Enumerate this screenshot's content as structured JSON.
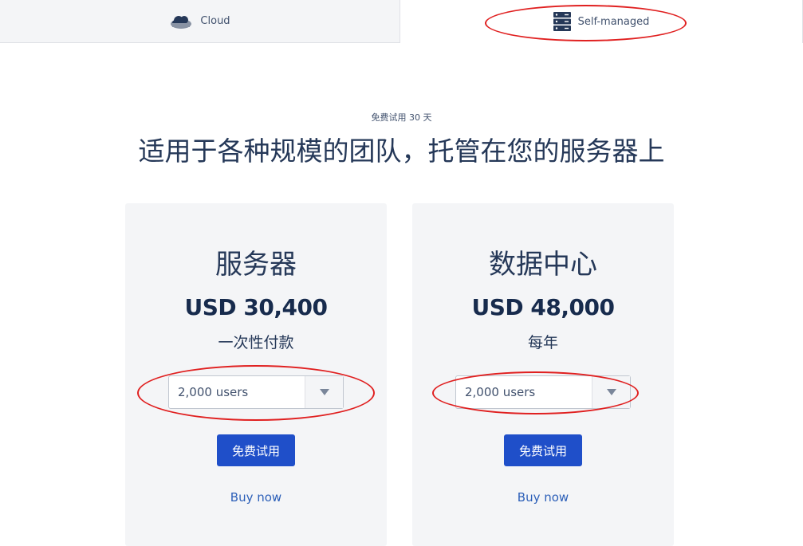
{
  "tabs": [
    {
      "label": "Cloud",
      "icon": "cloud-icon",
      "active": false
    },
    {
      "label": "Self-managed",
      "icon": "server-icon",
      "active": true
    }
  ],
  "header": {
    "eyebrow": "免费试用 30 天",
    "title": "适用于各种规模的团队，托管在您的服务器上"
  },
  "plans": [
    {
      "name": "服务器",
      "price": "USD 30,400",
      "period": "一次性付款",
      "users": "2,000 users",
      "trial_label": "免费试用",
      "buy_label": "Buy now"
    },
    {
      "name": "数据中心",
      "price": "USD 48,000",
      "period": "每年",
      "users": "2,000 users",
      "trial_label": "免费试用",
      "buy_label": "Buy now"
    }
  ],
  "colors": {
    "primary_button": "#1f4fc9",
    "link": "#2c5fb8",
    "card_background": "#f4f5f7",
    "annotation": "#e02020"
  }
}
